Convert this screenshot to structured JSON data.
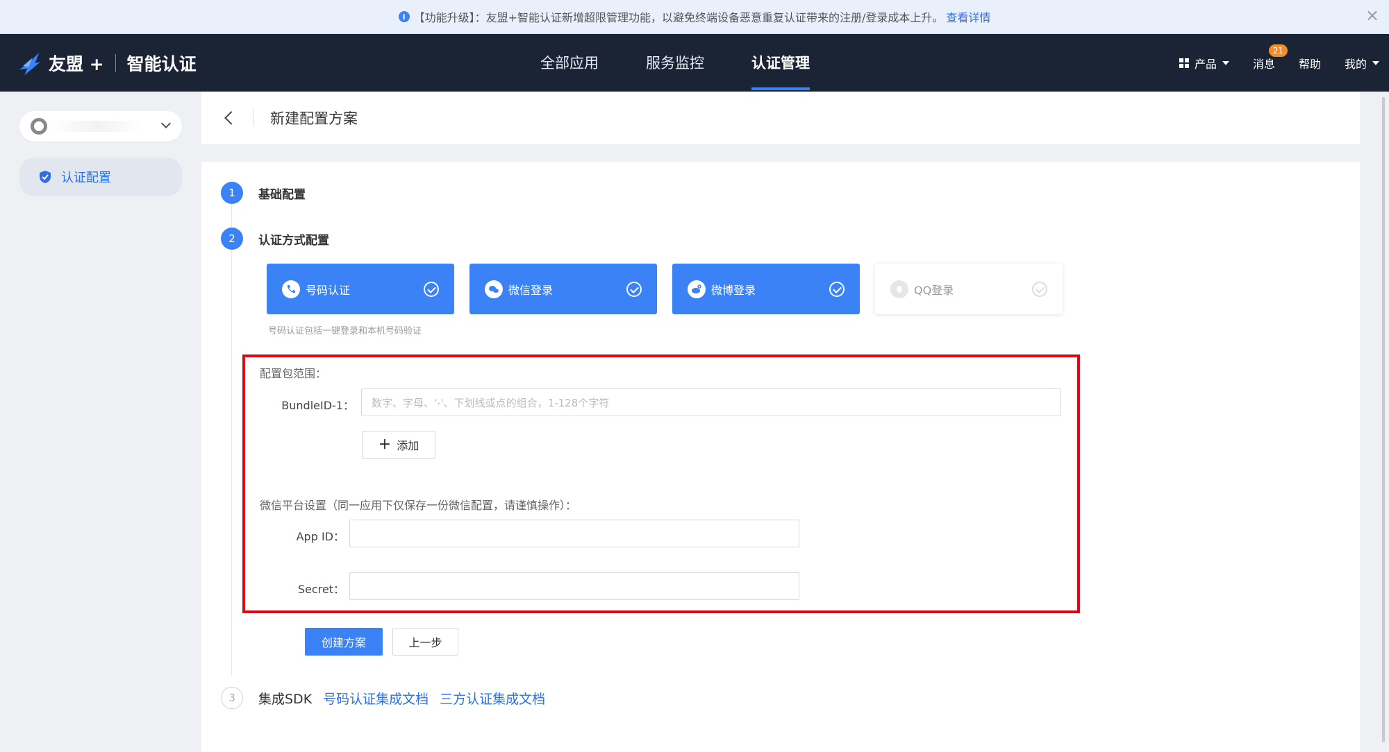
{
  "notice": {
    "icon": "info-icon",
    "text": "【功能升级】：友盟+智能认证新增超限管理功能，以避免终端设备恶意重复认证带来的注册/登录成本上升。",
    "link": "查看详情"
  },
  "brand": {
    "name": "友盟 +",
    "product": "智能认证"
  },
  "nav": {
    "tabs": [
      "全部应用",
      "服务监控",
      "认证管理"
    ],
    "active_index": 2,
    "right": {
      "products": "产品",
      "messages": "消息",
      "messages_badge": "21",
      "help": "帮助",
      "mine": "我的"
    }
  },
  "sidebar": {
    "items": [
      {
        "label": "认证配置",
        "icon": "shield-icon"
      }
    ]
  },
  "page": {
    "title": "新建配置方案"
  },
  "steps": [
    {
      "num": "1",
      "label": "基础配置"
    },
    {
      "num": "2",
      "label": "认证方式配置"
    },
    {
      "num": "3",
      "label": "集成SDK",
      "links": [
        "号码认证集成文档",
        "三方认证集成文档"
      ]
    }
  ],
  "auth_methods": [
    {
      "label": "号码认证",
      "icon": "phone-icon",
      "selected": true
    },
    {
      "label": "微信登录",
      "icon": "wechat-icon",
      "selected": true
    },
    {
      "label": "微博登录",
      "icon": "weibo-icon",
      "selected": true
    },
    {
      "label": "QQ登录",
      "icon": "qq-icon",
      "selected": false
    }
  ],
  "auth_hint": "号码认证包括一键登录和本机号码验证",
  "bundle": {
    "section_title": "配置包范围：",
    "label": "BundleID-1：",
    "placeholder": "数字、字母、'-'、下划线或点的组合，1-128个字符",
    "add_label": "添加"
  },
  "wechat": {
    "section_title": "微信平台设置（同一应用下仅保存一份微信配置，请谨慎操作）：",
    "appid_label": "App ID：",
    "secret_label": "Secret："
  },
  "actions": {
    "create": "创建方案",
    "prev": "上一步"
  },
  "colors": {
    "primary": "#3b82f6",
    "nav_bg": "#1b2434",
    "highlight_border": "#e60012",
    "badge": "#f08c2a"
  }
}
